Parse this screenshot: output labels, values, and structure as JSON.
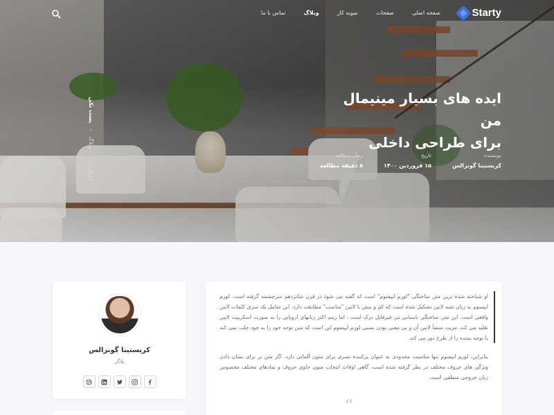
{
  "header": {
    "logo_text": "Starty",
    "menu": [
      {
        "label": "صفحه اصلی",
        "active": false
      },
      {
        "label": "صفحات",
        "active": false
      },
      {
        "label": "نمونه کار",
        "active": false
      },
      {
        "label": "وبلاگ",
        "active": true
      },
      {
        "label": "تماس با ما",
        "active": false
      }
    ],
    "search_icon": "search-icon"
  },
  "hero": {
    "title_line1": "ایده های بسیار مینیمال من",
    "title_line2": "برای طراحی داخلی",
    "meta": [
      {
        "label": "نویسنده",
        "value": "کریستینا گونزالس"
      },
      {
        "label": "تاریخ",
        "value": "۱۵ فروردین ۱۴۰۰"
      },
      {
        "label": "زمان مطالعه",
        "value": "۸ دقیقه مطالعه"
      }
    ],
    "breadcrumb": [
      "استارتی",
      "وبلاگ",
      "پست تکی"
    ]
  },
  "author": {
    "name": "کریستینا گونزالس",
    "role": "بلاگر",
    "socials": [
      "facebook-icon",
      "instagram-icon",
      "twitter-icon",
      "linkedin-icon",
      "dribbble-icon"
    ]
  },
  "article": {
    "paragraph1": "او شناخته شده ترین متن ساختگی \"لورم ایپسوم\" است که گفته می شود در قرن شانزدهم سرچشمه گرفته است. لورم ایپسوم به زبان شبه لاتین تشکیل شده است که کم و بیش با لاتین \"مناسب\" مطابقت دارد. این شامل یک سری کلمات لاتین واقعی است. این متن ساختگی باستانی نیز غیرقابل درک است ، اما ریتم اکثر زبانهای اروپایی را به صورت اسکریپت لاتین تقلید می کند. مزیت منشأ لاتین آن و بی معنی بودن نسبی لورم ایپسوم این است که متن توجه خود را به خود جلب نمی کند یا توجه بیننده را از طرح دور می کند.",
    "paragraph2": "بنابراین، لورم ایپسوم تنها مناسبت محدودی به عنوان پرکننده بصری برای متون آلمانی دارد. اگر متن بر برای نشان دادن ویژگی های حروف مختلف در نظر گرفته شده است، گاهی اوقات انتخاب متون حاوی حروف و نمادهای مختلف مخصوص زبان خروجی منطقی است."
  }
}
